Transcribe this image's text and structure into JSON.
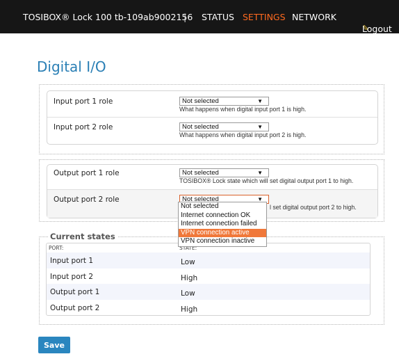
{
  "header": {
    "brand": "TOSIBOX® Lock 100 tb-109ab9002156",
    "separator": "|",
    "nav": {
      "status": "STATUS",
      "settings": "SETTINGS",
      "network": "NETWORK"
    },
    "logout": "Logout",
    "colors": {
      "bar": "#161616",
      "active": "#ff6a1f"
    }
  },
  "page": {
    "title": "Digital I/O",
    "title_color": "#2a7fb5"
  },
  "inputs": [
    {
      "label": "Input port 1 role",
      "value": "Not selected",
      "help": "What happens when digital input port 1 is high."
    },
    {
      "label": "Input port 2 role",
      "value": "Not selected",
      "help": "What happens when digital input port 2 is high."
    }
  ],
  "outputs": [
    {
      "label": "Output port 1 role",
      "value": "Not selected",
      "help": "TOSIBOX® Lock state which will set digital output port 1 to high."
    },
    {
      "label": "Output port 2 role",
      "value": "Not selected",
      "help": "l set digital output port 2 to high."
    }
  ],
  "dropdown": {
    "options": [
      "Not selected",
      "Internet connection OK",
      "Internet connection failed",
      "VPN connection active",
      "VPN connection inactive"
    ],
    "highlighted": "VPN connection active",
    "highlight_color": "#f0783a"
  },
  "current_states": {
    "legend": "Current states",
    "col_port": "PORT:",
    "col_state": "STATE:",
    "rows": [
      {
        "port": "Input port 1",
        "state": "Low"
      },
      {
        "port": "Input port 2",
        "state": "High"
      },
      {
        "port": "Output port 1",
        "state": "Low"
      },
      {
        "port": "Output port 2",
        "state": "High"
      }
    ]
  },
  "save_label": "Save",
  "icons": {
    "logout": "key-icon",
    "select": "chevron-down-icon"
  }
}
